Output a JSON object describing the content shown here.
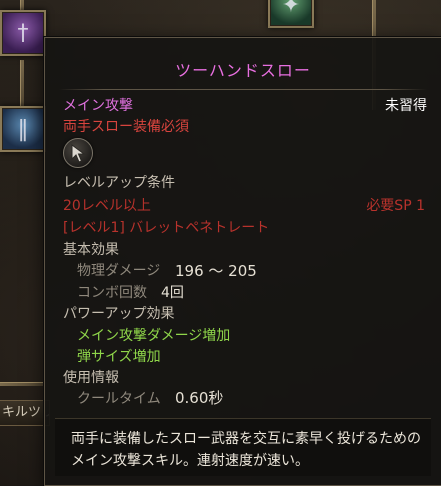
{
  "background": {
    "skill_tree_tab_label": "キルツリー"
  },
  "tooltip": {
    "title": "ツーハンドスロー",
    "attack_type": "メイン攻撃",
    "status": "未習得",
    "requirement": "両手スロー装備必須",
    "skill_icon": "cursor-arrow-icon",
    "levelup_heading": "レベルアップ条件",
    "level_requirement": "20レベル以上",
    "sp_requirement": "必要SP 1",
    "prereq_skill": "[レベル1] バレットペネトレート",
    "base_effect_heading": "基本効果",
    "base_effects": [
      {
        "label": "物理ダメージ",
        "value": "196 ～ 205"
      },
      {
        "label": "コンボ回数",
        "value": "4回"
      }
    ],
    "powerup_heading": "パワーアップ効果",
    "powerups": [
      "メイン攻撃ダメージ増加",
      "弾サイズ増加"
    ],
    "usage_heading": "使用情報",
    "usage": [
      {
        "label": "クールタイム",
        "value": "0.60秒"
      }
    ],
    "description_lines": [
      "両手に装備したスロー武器を交互に素早く投げるための",
      "メイン攻撃スキル。連射速度が速い。"
    ]
  },
  "colors": {
    "title": "#e86fe0",
    "attack_type": "#e071df",
    "requirement_unmet": "#d8443e",
    "powerup": "#8fd64a",
    "status": "#ffffff"
  }
}
